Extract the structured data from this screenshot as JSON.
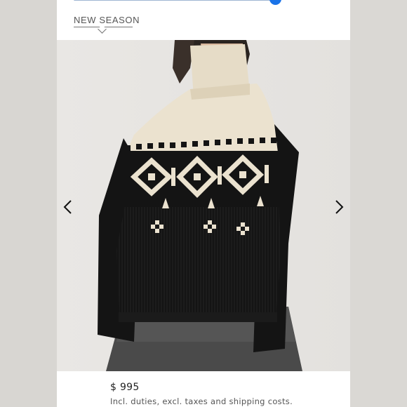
{
  "carousel": {
    "progress": 0.99
  },
  "product": {
    "badge": "NEW SEASON",
    "price": "$ 995",
    "price_note": "Incl. duties, excl. taxes and shipping costs."
  },
  "colors": {
    "accent": "#1a73e8",
    "sweater_black": "#141414",
    "sweater_cream": "#ebe2cf"
  }
}
